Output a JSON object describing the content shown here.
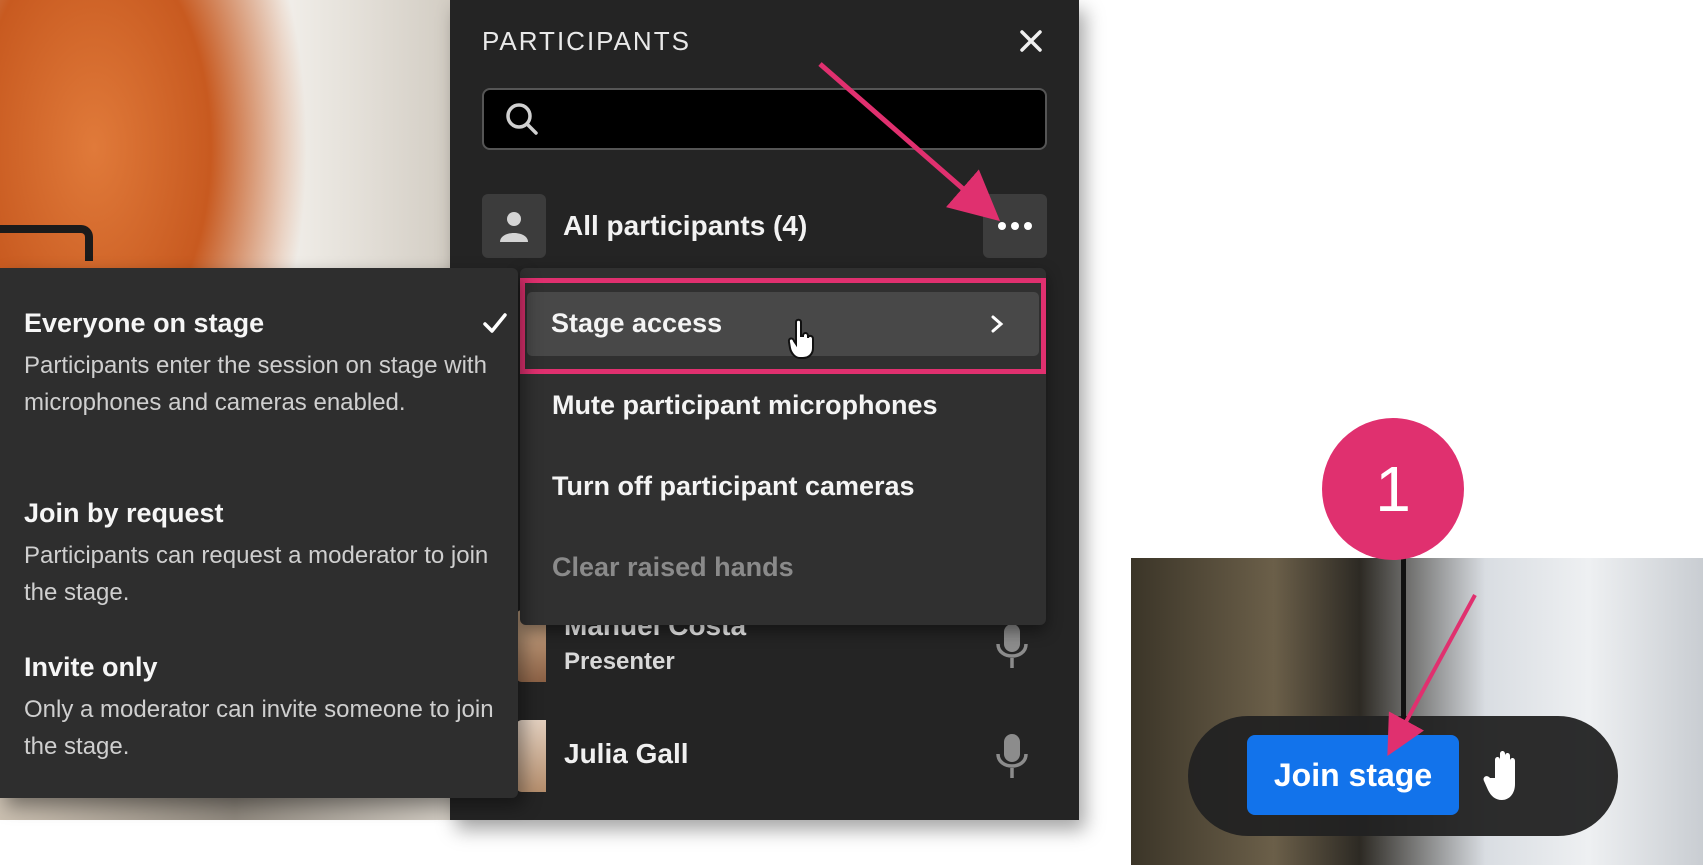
{
  "panel": {
    "title": "PARTICIPANTS",
    "search_placeholder": "",
    "all_participants_label": "All participants (4)"
  },
  "menu": {
    "items": [
      {
        "label": "Stage access",
        "has_submenu": true,
        "disabled": false
      },
      {
        "label": "Mute participant microphones",
        "disabled": false
      },
      {
        "label": "Turn off participant cameras",
        "disabled": false
      },
      {
        "label": "Clear raised hands",
        "disabled": true
      }
    ]
  },
  "submenu": {
    "options": [
      {
        "title": "Everyone on stage",
        "description": "Participants enter the session on stage with microphones and cameras enabled.",
        "selected": true
      },
      {
        "title": "Join by request",
        "description": "Participants can request a moderator to join the stage.",
        "selected": false
      },
      {
        "title": "Invite only",
        "description": "Only a moderator can invite someone to join the stage.",
        "selected": false
      }
    ]
  },
  "participants": [
    {
      "name": "Manuel Costa",
      "role": "Presenter",
      "mic": "mic-icon"
    },
    {
      "name": "Julia Gall",
      "role": "",
      "mic": "mic-icon"
    }
  ],
  "callout": {
    "step_number": "1",
    "join_stage_label": "Join stage",
    "raise_hand_icon": "raise-hand-icon"
  },
  "colors": {
    "panel_bg": "#242424",
    "menu_bg": "#303030",
    "highlight": "#e0306f",
    "join_button": "#1273eb"
  }
}
